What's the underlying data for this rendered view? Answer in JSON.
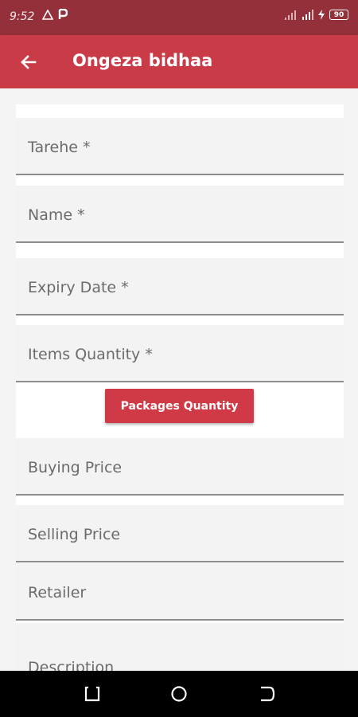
{
  "status_bar": {
    "time": "9:52",
    "battery": "90"
  },
  "app_bar": {
    "title": "Ongeza bidhaa",
    "back_icon": "arrow-back-icon"
  },
  "form": {
    "fields": [
      {
        "label": "Tarehe *"
      },
      {
        "label": "Name *"
      },
      {
        "label": "Expiry Date *"
      },
      {
        "label": "Items Quantity *"
      },
      {
        "label": "Buying Price"
      },
      {
        "label": "Selling Price"
      },
      {
        "label": "Retailer"
      },
      {
        "label": "Description"
      }
    ],
    "packages_button": "Packages Quantity"
  },
  "colors": {
    "status_bar": "#93303a",
    "app_bar": "#c93b46",
    "accent": "#cf3a46"
  }
}
